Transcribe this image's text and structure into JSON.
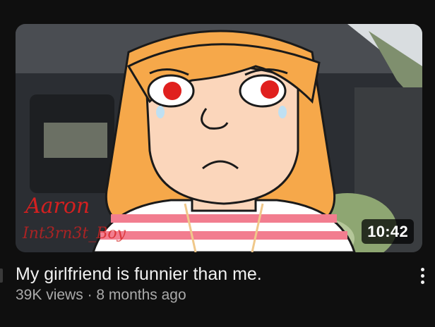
{
  "video": {
    "title": "My girlfriend is funnier than me.",
    "views": "39K views",
    "separator": "·",
    "age": "8 months ago",
    "duration": "10:42"
  },
  "thumbnail": {
    "watermark_line1": "Aaron",
    "watermark_line2": "Int3rn3t_Boy",
    "colors": {
      "hair": "#f6a84a",
      "skin": "#fbd6bb",
      "eye_red": "#e0201e",
      "shirt_stripe": "#f27d8f",
      "car_interior": "#2a2d31"
    }
  },
  "icons": {
    "more": "vertical-ellipsis-icon"
  }
}
